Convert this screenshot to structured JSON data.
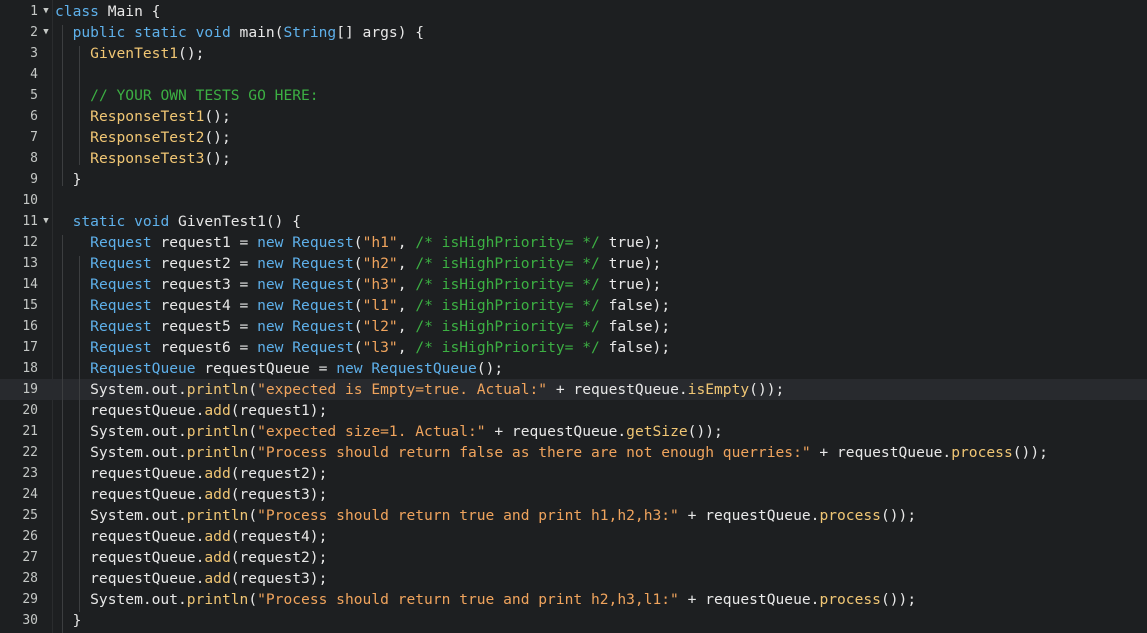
{
  "editor": {
    "current_line": 19,
    "colors": {
      "background": "#1d1f21",
      "current_line": "#282a2e",
      "keyword": "#5eb0ea",
      "function": "#f0c674",
      "string": "#f0a45d",
      "comment": "#3cb043",
      "text": "#e8e8e8"
    },
    "lines": [
      {
        "n": "1",
        "fold": "▼",
        "tokens": [
          [
            "kw",
            "class"
          ],
          [
            "plain",
            " Main {"
          ]
        ]
      },
      {
        "n": "2",
        "fold": "▼",
        "tokens": [
          [
            "plain",
            "  "
          ],
          [
            "kw",
            "public"
          ],
          [
            "plain",
            " "
          ],
          [
            "kw",
            "static"
          ],
          [
            "plain",
            " "
          ],
          [
            "kw",
            "void"
          ],
          [
            "plain",
            " main("
          ],
          [
            "type",
            "String"
          ],
          [
            "plain",
            "[] args) {"
          ]
        ]
      },
      {
        "n": "3",
        "fold": "",
        "tokens": [
          [
            "plain",
            "    "
          ],
          [
            "fn",
            "GivenTest1"
          ],
          [
            "plain",
            "();"
          ]
        ]
      },
      {
        "n": "4",
        "fold": "",
        "tokens": []
      },
      {
        "n": "5",
        "fold": "",
        "tokens": [
          [
            "plain",
            "    "
          ],
          [
            "cm",
            "// YOUR OWN TESTS GO HERE:"
          ]
        ]
      },
      {
        "n": "6",
        "fold": "",
        "tokens": [
          [
            "plain",
            "    "
          ],
          [
            "fn",
            "ResponseTest1"
          ],
          [
            "plain",
            "();"
          ]
        ]
      },
      {
        "n": "7",
        "fold": "",
        "tokens": [
          [
            "plain",
            "    "
          ],
          [
            "fn",
            "ResponseTest2"
          ],
          [
            "plain",
            "();"
          ]
        ]
      },
      {
        "n": "8",
        "fold": "",
        "tokens": [
          [
            "plain",
            "    "
          ],
          [
            "fn",
            "ResponseTest3"
          ],
          [
            "plain",
            "();"
          ]
        ]
      },
      {
        "n": "9",
        "fold": "",
        "tokens": [
          [
            "plain",
            "  }"
          ]
        ]
      },
      {
        "n": "10",
        "fold": "",
        "tokens": []
      },
      {
        "n": "11",
        "fold": "▼",
        "tokens": [
          [
            "plain",
            "  "
          ],
          [
            "kw",
            "static"
          ],
          [
            "plain",
            " "
          ],
          [
            "kw",
            "void"
          ],
          [
            "plain",
            " GivenTest1() {"
          ]
        ]
      },
      {
        "n": "12",
        "fold": "",
        "tokens": [
          [
            "plain",
            "    "
          ],
          [
            "type",
            "Request"
          ],
          [
            "plain",
            " request1 = "
          ],
          [
            "kw",
            "new"
          ],
          [
            "plain",
            " "
          ],
          [
            "type",
            "Request"
          ],
          [
            "plain",
            "("
          ],
          [
            "str",
            "\"h1\""
          ],
          [
            "plain",
            ", "
          ],
          [
            "cm",
            "/* isHighPriority= */"
          ],
          [
            "plain",
            " true);"
          ]
        ]
      },
      {
        "n": "13",
        "fold": "",
        "tokens": [
          [
            "plain",
            "    "
          ],
          [
            "type",
            "Request"
          ],
          [
            "plain",
            " request2 = "
          ],
          [
            "kw",
            "new"
          ],
          [
            "plain",
            " "
          ],
          [
            "type",
            "Request"
          ],
          [
            "plain",
            "("
          ],
          [
            "str",
            "\"h2\""
          ],
          [
            "plain",
            ", "
          ],
          [
            "cm",
            "/* isHighPriority= */"
          ],
          [
            "plain",
            " true);"
          ]
        ]
      },
      {
        "n": "14",
        "fold": "",
        "tokens": [
          [
            "plain",
            "    "
          ],
          [
            "type",
            "Request"
          ],
          [
            "plain",
            " request3 = "
          ],
          [
            "kw",
            "new"
          ],
          [
            "plain",
            " "
          ],
          [
            "type",
            "Request"
          ],
          [
            "plain",
            "("
          ],
          [
            "str",
            "\"h3\""
          ],
          [
            "plain",
            ", "
          ],
          [
            "cm",
            "/* isHighPriority= */"
          ],
          [
            "plain",
            " true);"
          ]
        ]
      },
      {
        "n": "15",
        "fold": "",
        "tokens": [
          [
            "plain",
            "    "
          ],
          [
            "type",
            "Request"
          ],
          [
            "plain",
            " request4 = "
          ],
          [
            "kw",
            "new"
          ],
          [
            "plain",
            " "
          ],
          [
            "type",
            "Request"
          ],
          [
            "plain",
            "("
          ],
          [
            "str",
            "\"l1\""
          ],
          [
            "plain",
            ", "
          ],
          [
            "cm",
            "/* isHighPriority= */"
          ],
          [
            "plain",
            " false);"
          ]
        ]
      },
      {
        "n": "16",
        "fold": "",
        "tokens": [
          [
            "plain",
            "    "
          ],
          [
            "type",
            "Request"
          ],
          [
            "plain",
            " request5 = "
          ],
          [
            "kw",
            "new"
          ],
          [
            "plain",
            " "
          ],
          [
            "type",
            "Request"
          ],
          [
            "plain",
            "("
          ],
          [
            "str",
            "\"l2\""
          ],
          [
            "plain",
            ", "
          ],
          [
            "cm",
            "/* isHighPriority= */"
          ],
          [
            "plain",
            " false);"
          ]
        ]
      },
      {
        "n": "17",
        "fold": "",
        "tokens": [
          [
            "plain",
            "    "
          ],
          [
            "type",
            "Request"
          ],
          [
            "plain",
            " request6 = "
          ],
          [
            "kw",
            "new"
          ],
          [
            "plain",
            " "
          ],
          [
            "type",
            "Request"
          ],
          [
            "plain",
            "("
          ],
          [
            "str",
            "\"l3\""
          ],
          [
            "plain",
            ", "
          ],
          [
            "cm",
            "/* isHighPriority= */"
          ],
          [
            "plain",
            " false);"
          ]
        ]
      },
      {
        "n": "18",
        "fold": "",
        "tokens": [
          [
            "plain",
            "    "
          ],
          [
            "type",
            "RequestQueue"
          ],
          [
            "plain",
            " requestQueue = "
          ],
          [
            "kw",
            "new"
          ],
          [
            "plain",
            " "
          ],
          [
            "type",
            "RequestQueue"
          ],
          [
            "plain",
            "();"
          ]
        ]
      },
      {
        "n": "19",
        "fold": "",
        "tokens": [
          [
            "plain",
            "    System.out."
          ],
          [
            "fn",
            "println"
          ],
          [
            "plain",
            "("
          ],
          [
            "str",
            "\"expected is Empty=true. Actual:\""
          ],
          [
            "plain",
            " + requestQueue."
          ],
          [
            "fn",
            "isEmpty"
          ],
          [
            "plain",
            "());"
          ]
        ]
      },
      {
        "n": "20",
        "fold": "",
        "tokens": [
          [
            "plain",
            "    requestQueue."
          ],
          [
            "fn",
            "add"
          ],
          [
            "plain",
            "(request1);"
          ]
        ]
      },
      {
        "n": "21",
        "fold": "",
        "tokens": [
          [
            "plain",
            "    System.out."
          ],
          [
            "fn",
            "println"
          ],
          [
            "plain",
            "("
          ],
          [
            "str",
            "\"expected size=1. Actual:\""
          ],
          [
            "plain",
            " + requestQueue."
          ],
          [
            "fn",
            "getSize"
          ],
          [
            "plain",
            "());"
          ]
        ]
      },
      {
        "n": "22",
        "fold": "",
        "tokens": [
          [
            "plain",
            "    System.out."
          ],
          [
            "fn",
            "println"
          ],
          [
            "plain",
            "("
          ],
          [
            "str",
            "\"Process should return false as there are not enough querries:\""
          ],
          [
            "plain",
            " + requestQueue."
          ],
          [
            "fn",
            "process"
          ],
          [
            "plain",
            "());"
          ]
        ]
      },
      {
        "n": "23",
        "fold": "",
        "tokens": [
          [
            "plain",
            "    requestQueue."
          ],
          [
            "fn",
            "add"
          ],
          [
            "plain",
            "(request2);"
          ]
        ]
      },
      {
        "n": "24",
        "fold": "",
        "tokens": [
          [
            "plain",
            "    requestQueue."
          ],
          [
            "fn",
            "add"
          ],
          [
            "plain",
            "(request3);"
          ]
        ]
      },
      {
        "n": "25",
        "fold": "",
        "tokens": [
          [
            "plain",
            "    System.out."
          ],
          [
            "fn",
            "println"
          ],
          [
            "plain",
            "("
          ],
          [
            "str",
            "\"Process should return true and print h1,h2,h3:\""
          ],
          [
            "plain",
            " + requestQueue."
          ],
          [
            "fn",
            "process"
          ],
          [
            "plain",
            "());"
          ]
        ]
      },
      {
        "n": "26",
        "fold": "",
        "tokens": [
          [
            "plain",
            "    requestQueue."
          ],
          [
            "fn",
            "add"
          ],
          [
            "plain",
            "(request4);"
          ]
        ]
      },
      {
        "n": "27",
        "fold": "",
        "tokens": [
          [
            "plain",
            "    requestQueue."
          ],
          [
            "fn",
            "add"
          ],
          [
            "plain",
            "(request2);"
          ]
        ]
      },
      {
        "n": "28",
        "fold": "",
        "tokens": [
          [
            "plain",
            "    requestQueue."
          ],
          [
            "fn",
            "add"
          ],
          [
            "plain",
            "(request3);"
          ]
        ]
      },
      {
        "n": "29",
        "fold": "",
        "tokens": [
          [
            "plain",
            "    System.out."
          ],
          [
            "fn",
            "println"
          ],
          [
            "plain",
            "("
          ],
          [
            "str",
            "\"Process should return true and print h2,h3,l1:\""
          ],
          [
            "plain",
            " + requestQueue."
          ],
          [
            "fn",
            "process"
          ],
          [
            "plain",
            "());"
          ]
        ]
      },
      {
        "n": "30",
        "fold": "",
        "tokens": [
          [
            "plain",
            "  }"
          ]
        ]
      }
    ]
  }
}
